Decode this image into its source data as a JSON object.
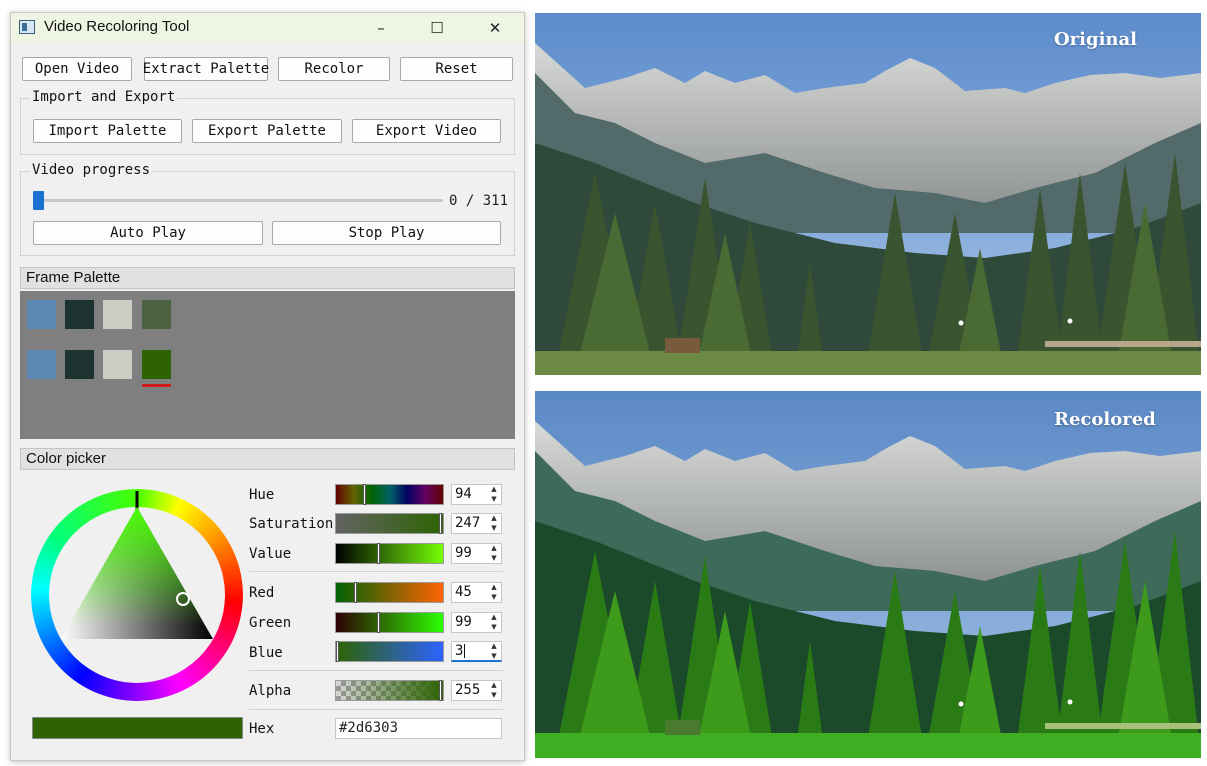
{
  "window": {
    "title": "Video Recoloring Tool",
    "icon": "video-app-icon",
    "controls": {
      "minimize": "–",
      "maximize": "☐",
      "close": "✕"
    }
  },
  "toolbar": {
    "open_video": "Open Video",
    "extract_palette": "Extract Palette",
    "recolor": "Recolor",
    "reset": "Reset"
  },
  "import_export": {
    "title": "Import and Export",
    "import_palette": "Import Palette",
    "export_palette": "Export Palette",
    "export_video": "Export Video"
  },
  "progress": {
    "title": "Video progress",
    "frame_text": "0 / 311",
    "current_frame": 0,
    "total_frames": 311,
    "auto_play": "Auto Play",
    "stop_play": "Stop Play"
  },
  "frame_palette": {
    "title": "Frame Palette",
    "original": [
      "#5b87b2",
      "#1d3331",
      "#ccccc4",
      "#4b6343"
    ],
    "recolored": [
      "#5b87b2",
      "#1d3331",
      "#ccccc4",
      "#2d6303"
    ],
    "selected_index": 3
  },
  "color_picker": {
    "title": "Color picker",
    "hue": {
      "label": "Hue",
      "value": "94"
    },
    "saturation": {
      "label": "Saturation",
      "value": "247"
    },
    "value": {
      "label": "Value",
      "value": "99"
    },
    "red": {
      "label": "Red",
      "value": "45"
    },
    "green": {
      "label": "Green",
      "value": "99"
    },
    "blue": {
      "label": "Blue",
      "value": "3"
    },
    "alpha": {
      "label": "Alpha",
      "value": "255"
    },
    "hex": {
      "label": "Hex",
      "value": "#2d6303"
    },
    "current_color": "#2d6303"
  },
  "images": {
    "original": {
      "label": "Original"
    },
    "recolored": {
      "label": "Recolored"
    }
  }
}
